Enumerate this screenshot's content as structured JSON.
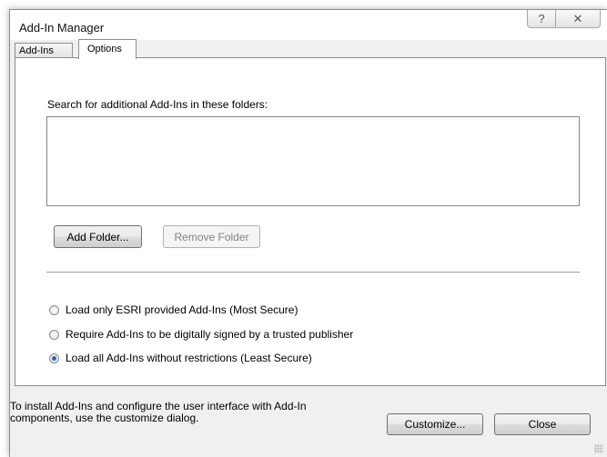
{
  "window": {
    "title": "Add-In Manager",
    "help_glyph": "?",
    "close_glyph": "✕"
  },
  "tabs": [
    {
      "label": "Add-Ins",
      "selected": false
    },
    {
      "label": "Options",
      "selected": true
    }
  ],
  "options": {
    "search_label": "Search for additional Add-Ins in these folders:",
    "folders": [],
    "add_folder_label": "Add Folder...",
    "remove_folder_label": "Remove Folder",
    "radios": [
      {
        "label": "Load only ESRI provided Add-Ins (Most Secure)",
        "checked": false
      },
      {
        "label": "Require Add-Ins to be digitally signed by a trusted publisher",
        "checked": false
      },
      {
        "label": "Load all Add-Ins without restrictions (Least Secure)",
        "checked": true
      }
    ]
  },
  "footer": {
    "text": "To install Add-Ins and configure the user interface with Add-In components, use the customize dialog.",
    "customize_label": "Customize...",
    "close_label": "Close"
  },
  "colors": {
    "radio_selected": "#2a62c7",
    "dialog_bg": "#f0f0f0"
  }
}
